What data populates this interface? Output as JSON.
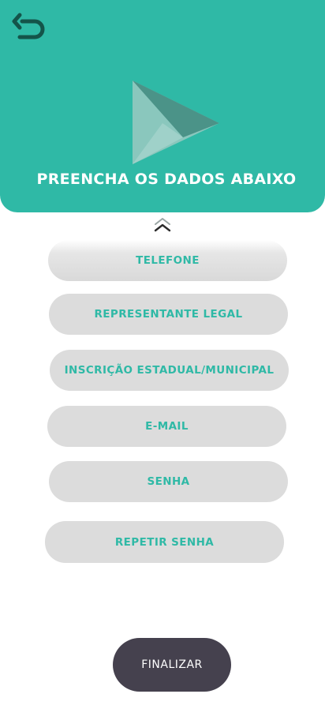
{
  "header": {
    "title": "PREENCHA OS DADOS ABAIXO",
    "back_icon": "undo-arrow-icon",
    "logo_icon": "play-triangle-logo"
  },
  "scroll_hint_icon": "double-chevron-up-icon",
  "fields": {
    "telefone": "TELEFONE",
    "representante": "REPRESENTANTE LEGAL",
    "inscricao": "INSCRIÇÃO ESTADUAL/MUNICIPAL",
    "email": "E-MAIL",
    "senha": "SENHA",
    "repetir_senha": "REPETIR SENHA"
  },
  "finish_button": "FINALIZAR",
  "colors": {
    "accent": "#2fb9a6",
    "field_bg": "#dcdcdc",
    "button_bg": "#45414e",
    "back_icon": "#14544a"
  }
}
